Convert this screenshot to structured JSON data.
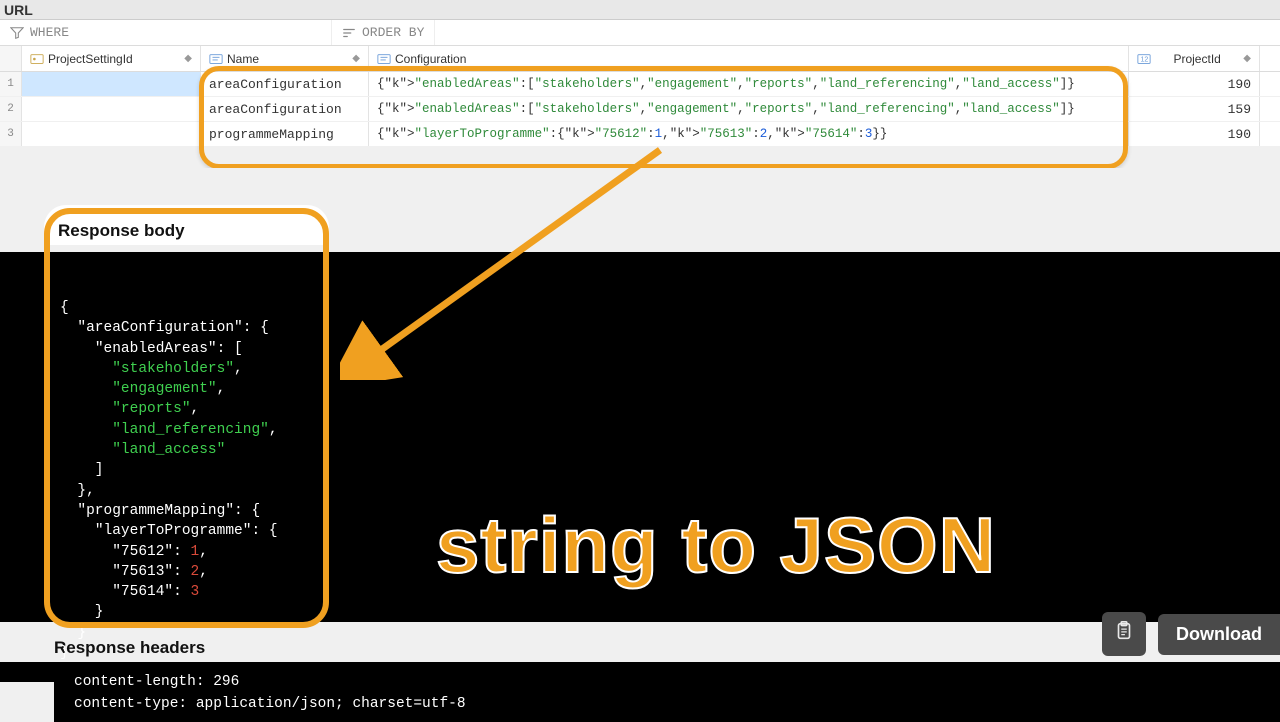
{
  "url_bar": {
    "label": "URL"
  },
  "filters": {
    "where_label": "WHERE",
    "orderby_label": "ORDER BY"
  },
  "columns": {
    "psid": "ProjectSettingId",
    "name": "Name",
    "config": "Configuration",
    "pid": "ProjectId"
  },
  "rows": [
    {
      "n": "1",
      "name": "areaConfiguration",
      "config_raw": "{\"enabledAreas\":[\"stakeholders\",\"engagement\",\"reports\",\"land_referencing\",\"land_access\"]}",
      "pid": "190"
    },
    {
      "n": "2",
      "name": "areaConfiguration",
      "config_raw": "{\"enabledAreas\":[\"stakeholders\",\"engagement\",\"reports\",\"land_referencing\",\"land_access\"]}",
      "pid": "159"
    },
    {
      "n": "3",
      "name": "programmeMapping",
      "config_raw": "{\"layerToProgramme\":{\"75612\":1,\"75613\":2,\"75614\":3}}",
      "pid": "190"
    }
  ],
  "response_body_label": "Response body",
  "big_text": "string to JSON",
  "download_label": "Download",
  "response_headers_label": "Response headers",
  "headers": {
    "line1": "content-length: 296",
    "line2": "content-type: application/json; charset=utf-8"
  },
  "response_json_display": {
    "areaConfiguration": {
      "enabledAreas": [
        "stakeholders",
        "engagement",
        "reports",
        "land_referencing",
        "land_access"
      ]
    },
    "programmeMapping": {
      "layerToProgramme": {
        "75612": 1,
        "75613": 2,
        "75614": 3
      }
    }
  },
  "colors": {
    "accent": "#f0a020",
    "json_string": "#2f8a3a",
    "json_num": "#1a5bd8"
  }
}
